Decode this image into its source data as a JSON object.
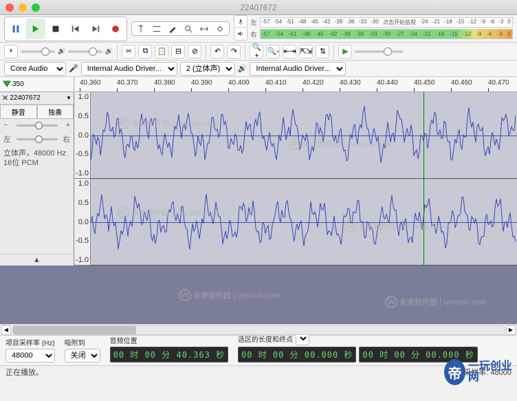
{
  "title": "22407672",
  "transport": {
    "pause": "⏸",
    "play": "▶",
    "stop": "⏹",
    "skip_start": "⏮",
    "skip_end": "⏭",
    "record": "⏺"
  },
  "meter": {
    "left_label": "左",
    "right_label": "右",
    "rec_hint": "点击开始监视",
    "ticks": [
      "-57",
      "-54",
      "-51",
      "-48",
      "-45",
      "-42",
      "-39",
      "-36",
      "-33",
      "-30",
      "-27",
      "-24",
      "-21",
      "-18",
      "-15",
      "-12",
      "-9",
      "-6",
      "-3",
      "0"
    ]
  },
  "device": {
    "host": "Core Audio",
    "rec_device": "Internal Audio Driver...",
    "channels": "2 (立体声)",
    "play_device": "Internal Audio Driver..."
  },
  "ruler": {
    "cursor": "350",
    "ticks": [
      "40.360",
      "40.370",
      "40.380",
      "40.390",
      "40.400",
      "40.410",
      "40.420",
      "40.430",
      "40.440",
      "40.450",
      "40.460",
      "40.470"
    ]
  },
  "track": {
    "name": "22407672",
    "mute": "静音",
    "solo": "独奏",
    "pan_l": "左",
    "pan_r": "右",
    "info1": "立体声，48000 Hz",
    "info2": "16位 PCM",
    "vscale": [
      "1.0",
      "0.5",
      "0.0",
      "-0.5",
      "-1.0"
    ]
  },
  "selection": {
    "rate_label": "项目采样率 (Hz)",
    "rate": "48000",
    "snap_label": "吸附到",
    "snap": "关闭",
    "pos_label": "音频位置",
    "pos": "00 时 00 分 40.363 秒",
    "len_label": "选区的长度和终点",
    "t1": "00 时 00 分 00.000 秒",
    "t2": "00 时 00 分 00.000 秒"
  },
  "status": {
    "left": "正在播放。",
    "right_label": "实际采样率:",
    "right_val": "48000"
  },
  "watermark": "未来软件园 | orsoon.com",
  "brand": "一玩创业网"
}
